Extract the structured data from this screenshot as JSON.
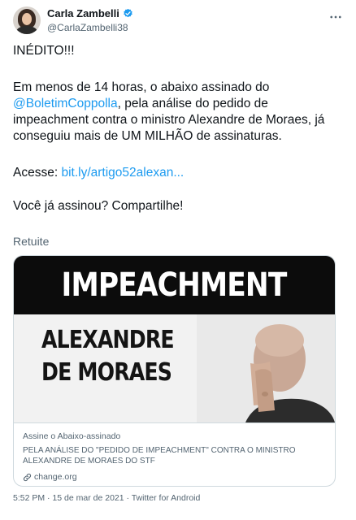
{
  "author": {
    "display_name": "Carla Zambelli",
    "handle": "@CarlaZambelli38"
  },
  "tweet": {
    "line1": "INÉDITO!!!",
    "para2_before": "Em menos de 14 horas, o abaixo assinado do ",
    "para2_mention": "@BoletimCoppolla",
    "para2_after": ", pela análise do pedido de impeachment contra o ministro Alexandre de Moraes, já conseguiu mais de UM MILHÃO de assinaturas.",
    "access_label": "Acesse: ",
    "access_link": "bit.ly/artigo52alexan...",
    "closing": "Você já assinou? Compartilhe!",
    "translate_label": "Retuite"
  },
  "card": {
    "banner": "IMPEACHMENT",
    "subtitle_line1": "ALEXANDRE",
    "subtitle_line2": "DE MORAES",
    "label": "Assine o Abaixo-assinado",
    "description": "PELA ANÁLISE DO \"PEDIDO DE IMPEACHMENT\" CONTRA O MINISTRO ALEXANDRE DE MORAES DO STF",
    "domain": "change.org"
  },
  "meta": {
    "timestamp": "5:52 PM · 15 de mar de 2021 · Twitter for Android"
  },
  "colors": {
    "link": "#1d9bf0",
    "secondary_text": "#536471",
    "verified": "#1d9bf0",
    "banner_bg": "#0c0c0c"
  },
  "icons": [
    "verified-badge-icon",
    "more-options-icon",
    "link-icon"
  ]
}
